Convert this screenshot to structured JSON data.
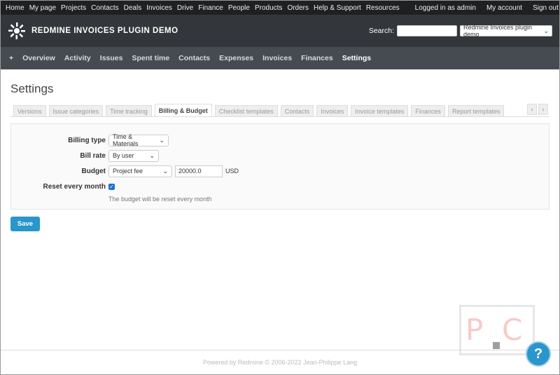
{
  "top_menu": {
    "items": [
      "Home",
      "My page",
      "Projects",
      "Contacts",
      "Deals",
      "Invoices",
      "Drive",
      "Finance",
      "People",
      "Products",
      "Orders",
      "Help & Support",
      "Resources"
    ],
    "logged_in": "Logged in as admin",
    "my_account": "My account",
    "sign_out": "Sign out"
  },
  "header": {
    "title": "REDMINE INVOICES PLUGIN DEMO",
    "search_label": "Search:",
    "search_value": "",
    "project_select": "Redmine Invoices plugin demo"
  },
  "main_menu": {
    "plus": "+",
    "items": [
      "Overview",
      "Activity",
      "Issues",
      "Spent time",
      "Contacts",
      "Expenses",
      "Invoices",
      "Finances",
      "Settings"
    ],
    "selected": "Settings"
  },
  "page": {
    "title": "Settings",
    "tabs": [
      "Versions",
      "Issue categories",
      "Time tracking",
      "Billing & Budget",
      "Checklist templates",
      "Contacts",
      "Invoices",
      "Invoice templates",
      "Finances",
      "Report templates"
    ],
    "selected_tab": "Billing & Budget"
  },
  "form": {
    "billing_type_label": "Billing type",
    "billing_type_value": "Time & Materials",
    "bill_rate_label": "Bill rate",
    "bill_rate_value": "By user",
    "budget_label": "Budget",
    "budget_type_value": "Project fee",
    "budget_amount": "20000.0",
    "budget_currency": "USD",
    "reset_label": "Reset every month",
    "reset_checked": true,
    "reset_hint": "The budget will be reset every month",
    "save_label": "Save"
  },
  "footer": {
    "text": "Powered by Redmine © 2006-2022 Jean-Philippe Lang"
  },
  "help": {
    "label": "?"
  },
  "colors": {
    "top_bar": "#1e2021",
    "header": "#33373b",
    "main_menu": "#454b51",
    "accent": "#2996cc"
  }
}
